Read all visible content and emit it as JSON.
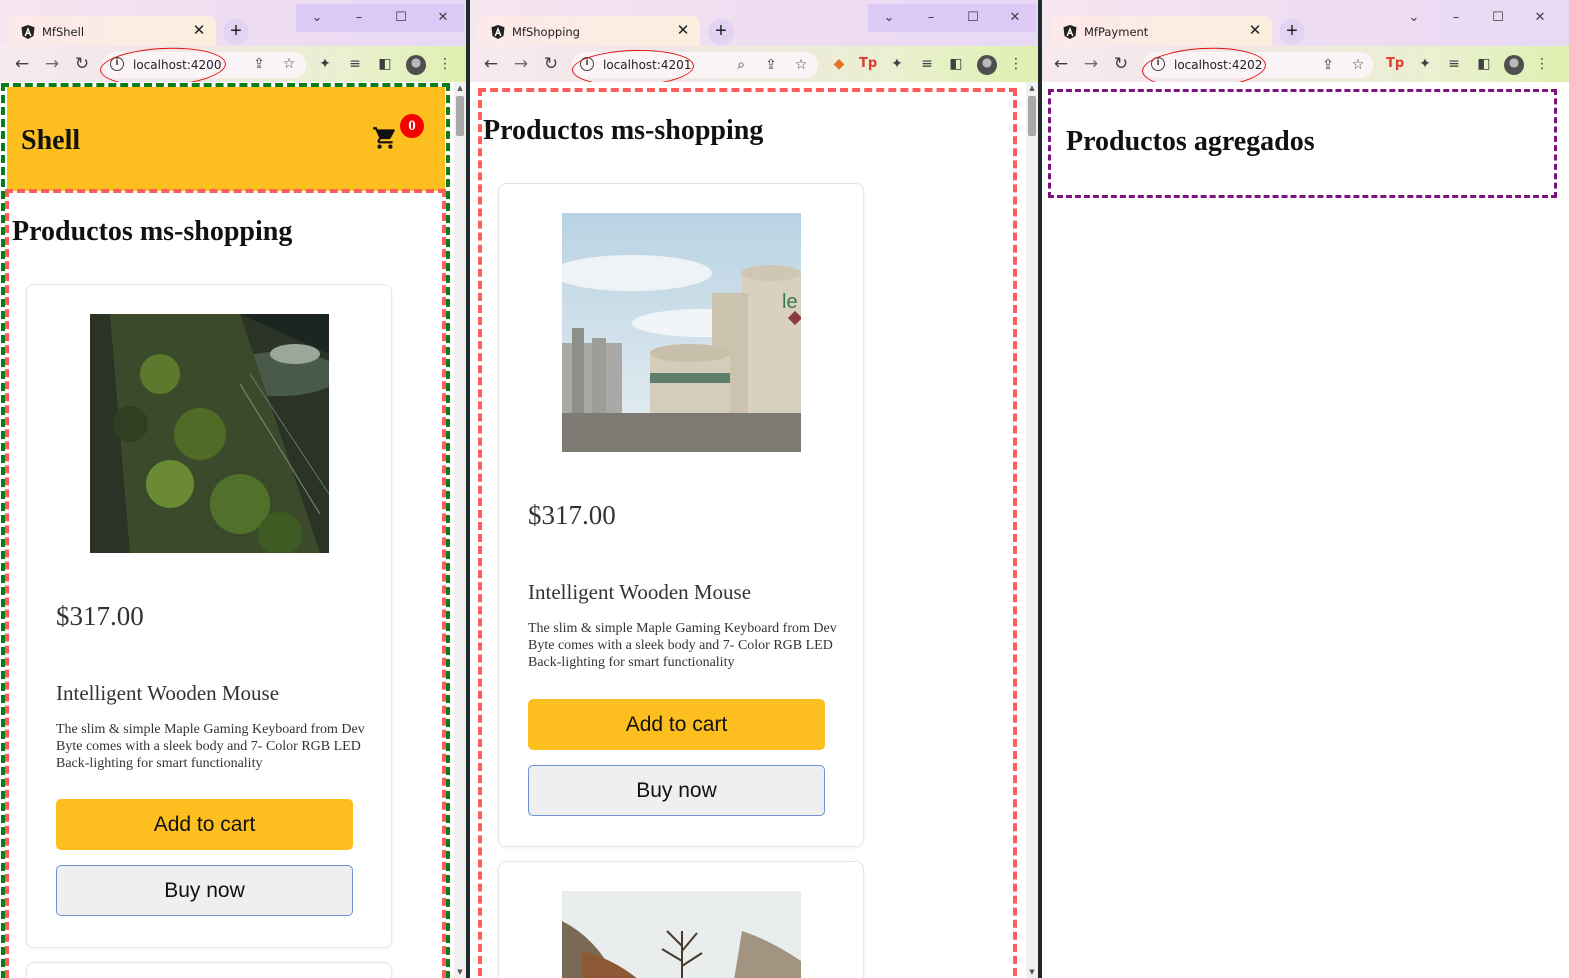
{
  "windows": [
    {
      "tab_title": "MfShell",
      "url": "localhost:4200",
      "app": {
        "header_title": "Shell",
        "cart_count": "0",
        "remote_heading": "Productos ms-shopping",
        "product": {
          "price": "$317.00",
          "name": "Intelligent Wooden Mouse",
          "description": "The slim & simple Maple Gaming Keyboard from Dev Byte comes with a sleek body and 7- Color RGB LED Back-lighting for smart functionality",
          "add_label": "Add to cart",
          "buy_label": "Buy now"
        }
      }
    },
    {
      "tab_title": "MfShopping",
      "url": "localhost:4201",
      "app": {
        "heading": "Productos ms-shopping",
        "product": {
          "price": "$317.00",
          "name": "Intelligent Wooden Mouse",
          "description": "The slim & simple Maple Gaming Keyboard from Dev Byte comes with a sleek body and 7- Color RGB LED Back-lighting for smart functionality",
          "add_label": "Add to cart",
          "buy_label": "Buy now"
        }
      }
    },
    {
      "tab_title": "MfPayment",
      "url": "localhost:4202",
      "app": {
        "heading": "Productos agregados"
      }
    }
  ],
  "browser": {
    "close_glyph": "✕",
    "new_tab_glyph": "+",
    "caption_glyphs": [
      "⌄",
      "–",
      "☐",
      "✕"
    ],
    "nav_glyphs": {
      "back": "←",
      "forward": "→",
      "reload": "↻"
    },
    "menu_glyph": "⋮"
  },
  "colors": {
    "shell_header": "#fcbf1f",
    "badge": "#f50000",
    "remote_border": "#ff5c5c",
    "shell_border": "#0b7d1a",
    "payment_border": "#7d1380",
    "url_highlight": "#e01010"
  }
}
